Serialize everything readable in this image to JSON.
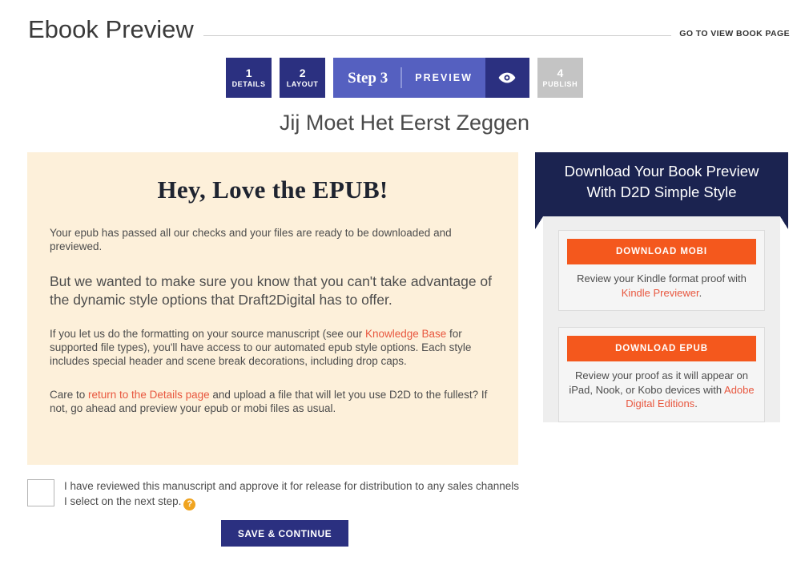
{
  "header": {
    "title": "Ebook Preview",
    "view_book_link": "GO TO VIEW BOOK PAGE"
  },
  "steps": {
    "items": [
      {
        "num": "1",
        "label": "DETAILS",
        "state": "complete"
      },
      {
        "num": "2",
        "label": "LAYOUT",
        "state": "complete"
      },
      {
        "num": "4",
        "label": "PUBLISH",
        "state": "inactive"
      }
    ],
    "active": {
      "step_word": "Step 3",
      "name": "PREVIEW",
      "icon": "eye-icon"
    }
  },
  "book": {
    "title": "Jij Moet Het Eerst Zeggen"
  },
  "notice": {
    "heading": "Hey, Love the EPUB!",
    "paragraph_1": "Your epub has passed all our checks and your files are ready to be downloaded and previewed.",
    "paragraph_2": "But we wanted to make sure you know that you can't take advantage of the dynamic style options that Draft2Digital has to offer.",
    "paragraph_3_part_1": "If you let us do the formatting on your source manuscript (see our ",
    "paragraph_3_link": "Knowledge Base",
    "paragraph_3_part_2": " for supported file types), you'll have access to our automated epub style options. Each style includes special header and scene break decorations, including drop caps.",
    "paragraph_4_part_1": "Care to ",
    "paragraph_4_link": "return to the Details page",
    "paragraph_4_part_2": " and upload a file that will let you use D2D to the fullest? If not, go ahead and preview your epub or mobi files as usual."
  },
  "download": {
    "banner_line_1": "Download Your Book Preview",
    "banner_line_2": "With D2D Simple Style",
    "cards": [
      {
        "button_label": "DOWNLOAD MOBI",
        "desc_before": "Review your Kindle format proof with ",
        "desc_link": "Kindle Previewer",
        "desc_after": "."
      },
      {
        "button_label": "DOWNLOAD EPUB",
        "desc_before": "Review your proof as it will appear on iPad, Nook, or Kobo devices with ",
        "desc_link": "Adobe Digital Editions",
        "desc_after": "."
      }
    ]
  },
  "approval": {
    "text": "I have reviewed this manuscript and approve it for release for distribution to any sales channels I select on the next step.",
    "help_icon": "?",
    "checked": false
  },
  "footer": {
    "save_label": "SAVE & CONTINUE"
  },
  "colors": {
    "navy": "#2b3080",
    "dark_navy": "#1b2350",
    "active_step": "#5560c0",
    "inactive_step": "#c4c4c4",
    "cream": "#fdf0da",
    "orange": "#f4581d",
    "link_orange": "#e8573f",
    "help_yellow": "#f0a420"
  }
}
